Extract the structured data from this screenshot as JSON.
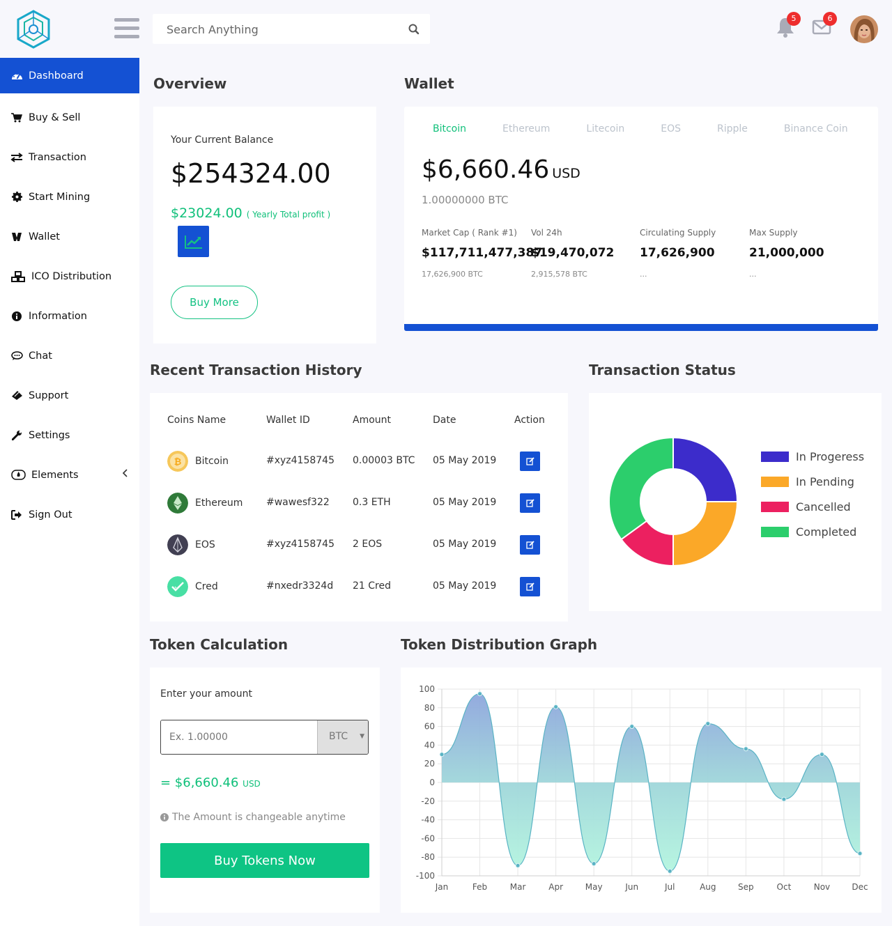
{
  "search": {
    "placeholder": "Search Anything"
  },
  "notifications": {
    "bell_count": "5",
    "mail_count": "6"
  },
  "sidebar": {
    "items": [
      {
        "label": "Dashboard",
        "icon": "dashboard-icon"
      },
      {
        "label": "Buy & Sell",
        "icon": "cart-icon"
      },
      {
        "label": "Transaction",
        "icon": "exchange-icon"
      },
      {
        "label": "Start Mining",
        "icon": "gear-icon"
      },
      {
        "label": "Wallet",
        "icon": "wallet-icon"
      },
      {
        "label": "ICO Distribution",
        "icon": "cubes-icon"
      },
      {
        "label": "Information",
        "icon": "info-icon"
      },
      {
        "label": "Chat",
        "icon": "chat-icon"
      },
      {
        "label": "Support",
        "icon": "ticket-icon"
      },
      {
        "label": "Settings",
        "icon": "wrench-icon"
      },
      {
        "label": "Elements",
        "icon": "fire-icon"
      },
      {
        "label": "Sign Out",
        "icon": "sign-out-icon"
      }
    ]
  },
  "overview": {
    "title": "Overview",
    "balance_label": "Your Current Balance",
    "balance": "$254324.00",
    "profit": "$23024.00",
    "profit_note": "( Yearly Total profit )",
    "buy_more": "Buy More"
  },
  "wallet": {
    "title": "Wallet",
    "tabs": [
      "Bitcoin",
      "Ethereum",
      "Litecoin",
      "EOS",
      "Ripple",
      "Binance Coin"
    ],
    "price": "$6,660.46",
    "currency": "USD",
    "btc_amount": "1.00000000 BTC",
    "stats": [
      {
        "label": "Market Cap ( Rank #1)",
        "value": "$117,711,477,387",
        "sub": "17,626,900 BTC"
      },
      {
        "label": "Vol 24h",
        "value": "$19,470,072",
        "sub": "2,915,578 BTC"
      },
      {
        "label": "Circulating Supply",
        "value": "17,626,900",
        "sub": "..."
      },
      {
        "label": "Max Supply",
        "value": "21,000,000",
        "sub": "..."
      }
    ]
  },
  "transactions": {
    "title": "Recent Transaction History",
    "columns": [
      "Coins Name",
      "Wallet ID",
      "Amount",
      "Date",
      "Action"
    ],
    "rows": [
      {
        "coin": "Bitcoin",
        "wallet_id": "#xyz4158745",
        "amount": "0.00003 BTC",
        "date": "05 May 2019"
      },
      {
        "coin": "Ethereum",
        "wallet_id": "#wawesf322",
        "amount": "0.3 ETH",
        "date": "05 May 2019"
      },
      {
        "coin": "EOS",
        "wallet_id": "#xyz4158745",
        "amount": "2 EOS",
        "date": "05 May 2019"
      },
      {
        "coin": "Cred",
        "wallet_id": "#nxedr3324d",
        "amount": "21 Cred",
        "date": "05 May 2019"
      }
    ]
  },
  "status": {
    "title": "Transaction Status",
    "legend": [
      {
        "label": "In Progeress",
        "color": "#3c2ccb"
      },
      {
        "label": "In Pending",
        "color": "#fba828"
      },
      {
        "label": "Cancelled",
        "color": "#ec2060"
      },
      {
        "label": "Completed",
        "color": "#2cce6c"
      }
    ],
    "values": [
      25,
      25,
      15,
      35
    ]
  },
  "token_calc": {
    "title": "Token Calculation",
    "label": "Enter your amount",
    "placeholder": "Ex. 1.00000",
    "currency": "BTC",
    "result": "= $6,660.46",
    "result_unit": "USD",
    "note": "The Amount is changeable anytime",
    "buy_button": "Buy Tokens Now"
  },
  "chart_data": {
    "type": "area",
    "title": "Token Distribution Graph",
    "categories": [
      "Jan",
      "Feb",
      "Mar",
      "Apr",
      "May",
      "Jun",
      "Jul",
      "Aug",
      "Sep",
      "Oct",
      "Nov",
      "Dec"
    ],
    "values": [
      30,
      95,
      -89,
      81,
      -87,
      60,
      -95,
      63,
      36,
      -18,
      30,
      -76
    ],
    "ylim": [
      -100,
      100
    ],
    "yticks": [
      100,
      80,
      60,
      40,
      20,
      0,
      -20,
      -40,
      -60,
      -80,
      -100
    ],
    "grid": true
  }
}
